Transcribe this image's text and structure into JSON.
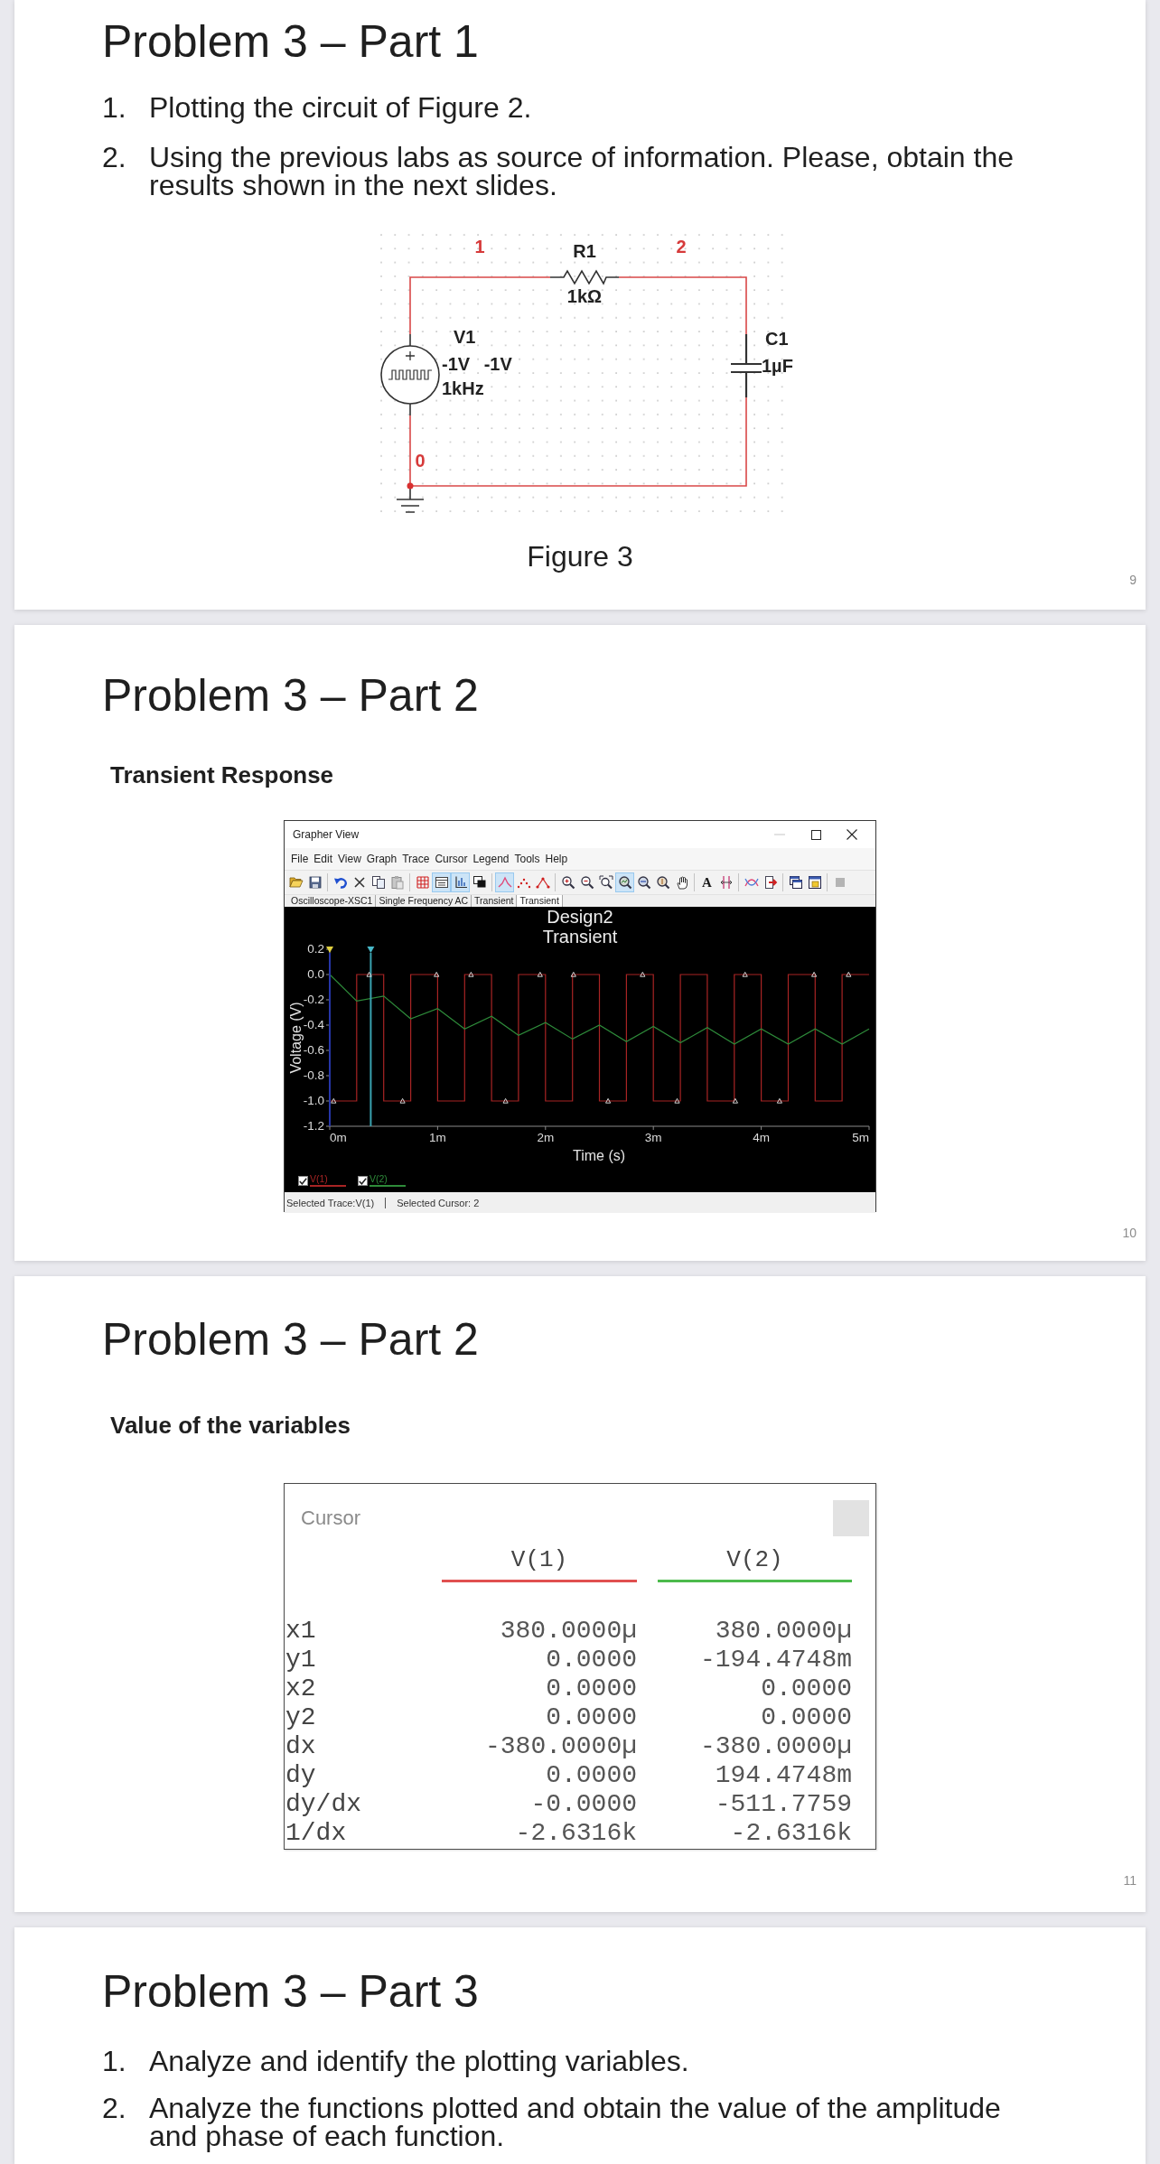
{
  "slides": [
    {
      "kind": "circuit",
      "title": "Problem 3 – Part 1",
      "items": [
        {
          "number": "1.",
          "text": "Plotting the circuit of Figure 2."
        },
        {
          "number": "2.",
          "text": "Using the previous labs as source of information. Please, obtain the results shown in the next slides."
        }
      ],
      "circuit": {
        "nodes": [
          "1",
          "2",
          "0"
        ],
        "components": [
          {
            "kind": "resistor",
            "name": "R1",
            "values": [
              "1kΩ"
            ]
          },
          {
            "kind": "source",
            "name": "V1",
            "values": [
              "-1V -1V",
              "1kHz"
            ]
          },
          {
            "kind": "capacitor",
            "name": "C1",
            "values": [
              "1µF"
            ]
          }
        ]
      },
      "caption": "Figure 3",
      "page": "9"
    },
    {
      "kind": "grapher",
      "title": "Problem 3 – Part 2",
      "subtitle": "Transient Response",
      "window": {
        "title": "Grapher View",
        "menu": [
          "File",
          "Edit",
          "View",
          "Graph",
          "Trace",
          "Cursor",
          "Legend",
          "Tools",
          "Help"
        ],
        "toolbar": [
          [
            {
              "kind": "folder",
              "pressed": false
            },
            {
              "kind": "save",
              "pressed": false
            }
          ],
          [
            {
              "kind": "undo",
              "pressed": false
            },
            {
              "kind": "delete",
              "pressed": false
            },
            {
              "kind": "copy",
              "pressed": false
            },
            {
              "kind": "paste",
              "pressed": false
            }
          ],
          [
            {
              "kind": "grid",
              "pressed": false
            },
            {
              "kind": "legend",
              "pressed": true
            },
            {
              "kind": "axes",
              "pressed": true
            },
            {
              "kind": "overlay",
              "pressed": false
            }
          ],
          [
            {
              "kind": "line",
              "pressed": true
            },
            {
              "kind": "dots",
              "pressed": false
            },
            {
              "kind": "line_dots",
              "pressed": false
            }
          ],
          [
            {
              "kind": "zoom_in",
              "pressed": false
            },
            {
              "kind": "zoom_out",
              "pressed": false
            },
            {
              "kind": "zoom_area",
              "pressed": false
            },
            {
              "kind": "zoom_fit",
              "pressed": true
            },
            {
              "kind": "zoom_x",
              "pressed": false
            },
            {
              "kind": "zoom_y",
              "pressed": false
            },
            {
              "kind": "hand",
              "pressed": false
            }
          ],
          [
            {
              "kind": "text",
              "label": "A",
              "pressed": false
            },
            {
              "kind": "cursors",
              "pressed": false
            }
          ],
          [
            {
              "kind": "trace",
              "pressed": false
            },
            {
              "kind": "export",
              "pressed": false
            }
          ],
          [
            {
              "kind": "copy_plot",
              "pressed": false
            },
            {
              "kind": "paste_plot",
              "pressed": false
            }
          ],
          [
            {
              "kind": "stop",
              "pressed": false
            }
          ]
        ],
        "tabs": [
          {
            "label": "Oscilloscope-XSC1",
            "selected": false
          },
          {
            "label": "Single Frequency AC",
            "selected": false
          },
          {
            "label": "Transient",
            "selected": false
          },
          {
            "label": "Transient",
            "selected": true
          }
        ],
        "chart_data": {
          "type": "line",
          "title": "Design2 Transient",
          "xlabel": "Time (s)",
          "ylabel": "Voltage (V)",
          "x": [
            0,
            0.25,
            0.25,
            0.5,
            0.5,
            0.75,
            0.75,
            1,
            1,
            1.25,
            1.25,
            1.5,
            1.5,
            1.75,
            1.75,
            2,
            2,
            2.25,
            2.25,
            2.5,
            2.5,
            2.75,
            2.75,
            3,
            3,
            3.25,
            3.25,
            3.5,
            3.5,
            3.75,
            3.75,
            4,
            4,
            4.25,
            4.25,
            4.5,
            4.5,
            4.75,
            4.75,
            5
          ],
          "series": [
            {
              "name": "V(1)",
              "color": "#a82424",
              "values": [
                -1,
                -1,
                0,
                0,
                -1,
                -1,
                0,
                0,
                -1,
                -1,
                0,
                0,
                -1,
                -1,
                0,
                0,
                -1,
                -1,
                0,
                0,
                -1,
                -1,
                0,
                0,
                -1,
                -1,
                0,
                0,
                -1,
                -1,
                0,
                0,
                -1,
                -1,
                0,
                0,
                -1,
                -1,
                0,
                0
              ]
            },
            {
              "name": "V(2)",
              "color": "#2e8b3a",
              "values": [
                0,
                -0.21,
                -0.21,
                -0.17,
                -0.17,
                -0.35,
                -0.35,
                -0.27,
                -0.27,
                -0.43,
                -0.43,
                -0.33,
                -0.33,
                -0.48,
                -0.48,
                -0.38,
                -0.38,
                -0.51,
                -0.51,
                -0.4,
                -0.4,
                -0.53,
                -0.53,
                -0.41,
                -0.41,
                -0.54,
                -0.54,
                -0.42,
                -0.42,
                -0.55,
                -0.55,
                -0.43,
                -0.43,
                -0.55,
                -0.55,
                -0.43,
                -0.43,
                -0.55,
                -0.55,
                -0.43
              ]
            }
          ],
          "xlim": [
            0,
            5
          ],
          "ylim": [
            -1.2,
            0.2
          ],
          "xticks": [
            {
              "value": 0,
              "label": "0m"
            },
            {
              "value": 1,
              "label": "1m"
            },
            {
              "value": 2,
              "label": "2m"
            },
            {
              "value": 3,
              "label": "3m"
            },
            {
              "value": 4,
              "label": "4m"
            },
            {
              "value": 5,
              "label": "5m"
            }
          ],
          "yticks": [
            {
              "value": 0.2,
              "label": "0.2"
            },
            {
              "value": 0,
              "label": "0.0"
            },
            {
              "value": -0.2,
              "label": "-0.2"
            },
            {
              "value": -0.4,
              "label": "-0.4"
            },
            {
              "value": -0.6,
              "label": "-0.6"
            },
            {
              "value": -0.8,
              "label": "-0.8"
            },
            {
              "value": -1,
              "label": "-1.0"
            },
            {
              "value": -1.2,
              "label": "-1.2"
            }
          ],
          "ref_lines": [
            {
              "axis": "x",
              "value": 0,
              "color": "#2636a8"
            },
            {
              "axis": "x",
              "value": 0.38,
              "color": "#3aa3b0"
            }
          ]
        },
        "legend": [
          {
            "checked": true
          },
          {
            "checked": true
          }
        ],
        "status_bar": [
          "Selected Trace:V(1)",
          "Selected Cursor: 2"
        ]
      },
      "page": "10"
    },
    {
      "kind": "cursor",
      "title": "Problem 3 – Part 2",
      "subtitle": "Value of the variables",
      "panel": {
        "title": "Cursor",
        "columns": [
          {
            "label": "V(1)",
            "color": "#e05050"
          },
          {
            "label": "V(2)",
            "color": "#4cbb4c"
          }
        ],
        "rows": [
          {
            "label": "x1",
            "values": [
              "380.0000µ",
              "380.0000µ"
            ]
          },
          {
            "label": "y1",
            "values": [
              "0.0000",
              "-194.4748m"
            ]
          },
          {
            "label": "x2",
            "values": [
              "0.0000",
              "0.0000"
            ]
          },
          {
            "label": "y2",
            "values": [
              "0.0000",
              "0.0000"
            ]
          },
          {
            "label": "dx",
            "values": [
              "-380.0000µ",
              "-380.0000µ"
            ]
          },
          {
            "label": "dy",
            "values": [
              "0.0000",
              "194.4748m"
            ]
          },
          {
            "label": "dy/dx",
            "values": [
              "-0.0000",
              "-511.7759"
            ]
          },
          {
            "label": "1/dx",
            "values": [
              "-2.6316k",
              "-2.6316k"
            ]
          }
        ]
      },
      "page": "11"
    },
    {
      "kind": "list",
      "title": "Problem 3 – Part 3",
      "items": [
        {
          "number": "1.",
          "text": "Analyze and identify the plotting variables."
        },
        {
          "number": "2.",
          "text": "Analyze the functions plotted and obtain the value of the amplitude and phase of each function."
        }
      ]
    }
  ]
}
